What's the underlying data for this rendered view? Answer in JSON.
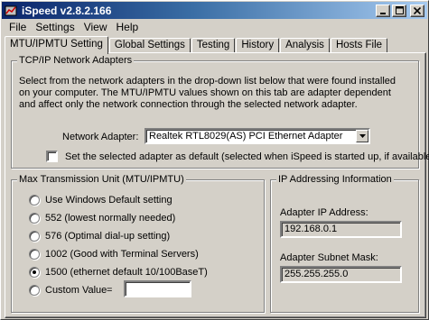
{
  "window": {
    "title": "iSpeed v2.8.2.166"
  },
  "menu": {
    "items": [
      "File",
      "Settings",
      "View",
      "Help"
    ]
  },
  "tabs": [
    "MTU/IPMTU Setting",
    "Global Settings",
    "Testing",
    "History",
    "Analysis",
    "Hosts File"
  ],
  "adapters_group": {
    "title": "TCP/IP Network Adapters",
    "description": "Select from the network adapters in the drop-down list below that were found installed on your computer. The MTU/IPMTU values shown on this tab are adapter dependent and affect only the network connection through the selected network adapter.",
    "adapter_label": "Network Adapter:",
    "adapter_value": "Realtek RTL8029(AS) PCI Ethernet Adapter",
    "default_checkbox_label": "Set the selected adapter as default (selected when iSpeed is started up, if available)",
    "default_checked": false
  },
  "mtu_group": {
    "title": "Max Transmission Unit (MTU/IPMTU)",
    "options": [
      "Use Windows Default setting",
      "552 (lowest normally needed)",
      "576 (Optimal dial-up setting)",
      "1002 (Good with Terminal Servers)",
      "1500 (ethernet default 10/100BaseT)",
      "Custom Value"
    ],
    "selected_index": 4,
    "custom_equals": "=",
    "custom_value": ""
  },
  "ip_group": {
    "title": "IP Addressing Information",
    "ip_label": "Adapter IP Address:",
    "ip_value": "192.168.0.1",
    "mask_label": "Adapter Subnet Mask:",
    "mask_value": "255.255.255.0"
  },
  "colors": {
    "titlebar_start": "#0a246a",
    "titlebar_end": "#a6caf0",
    "face": "#d4d0c8"
  }
}
